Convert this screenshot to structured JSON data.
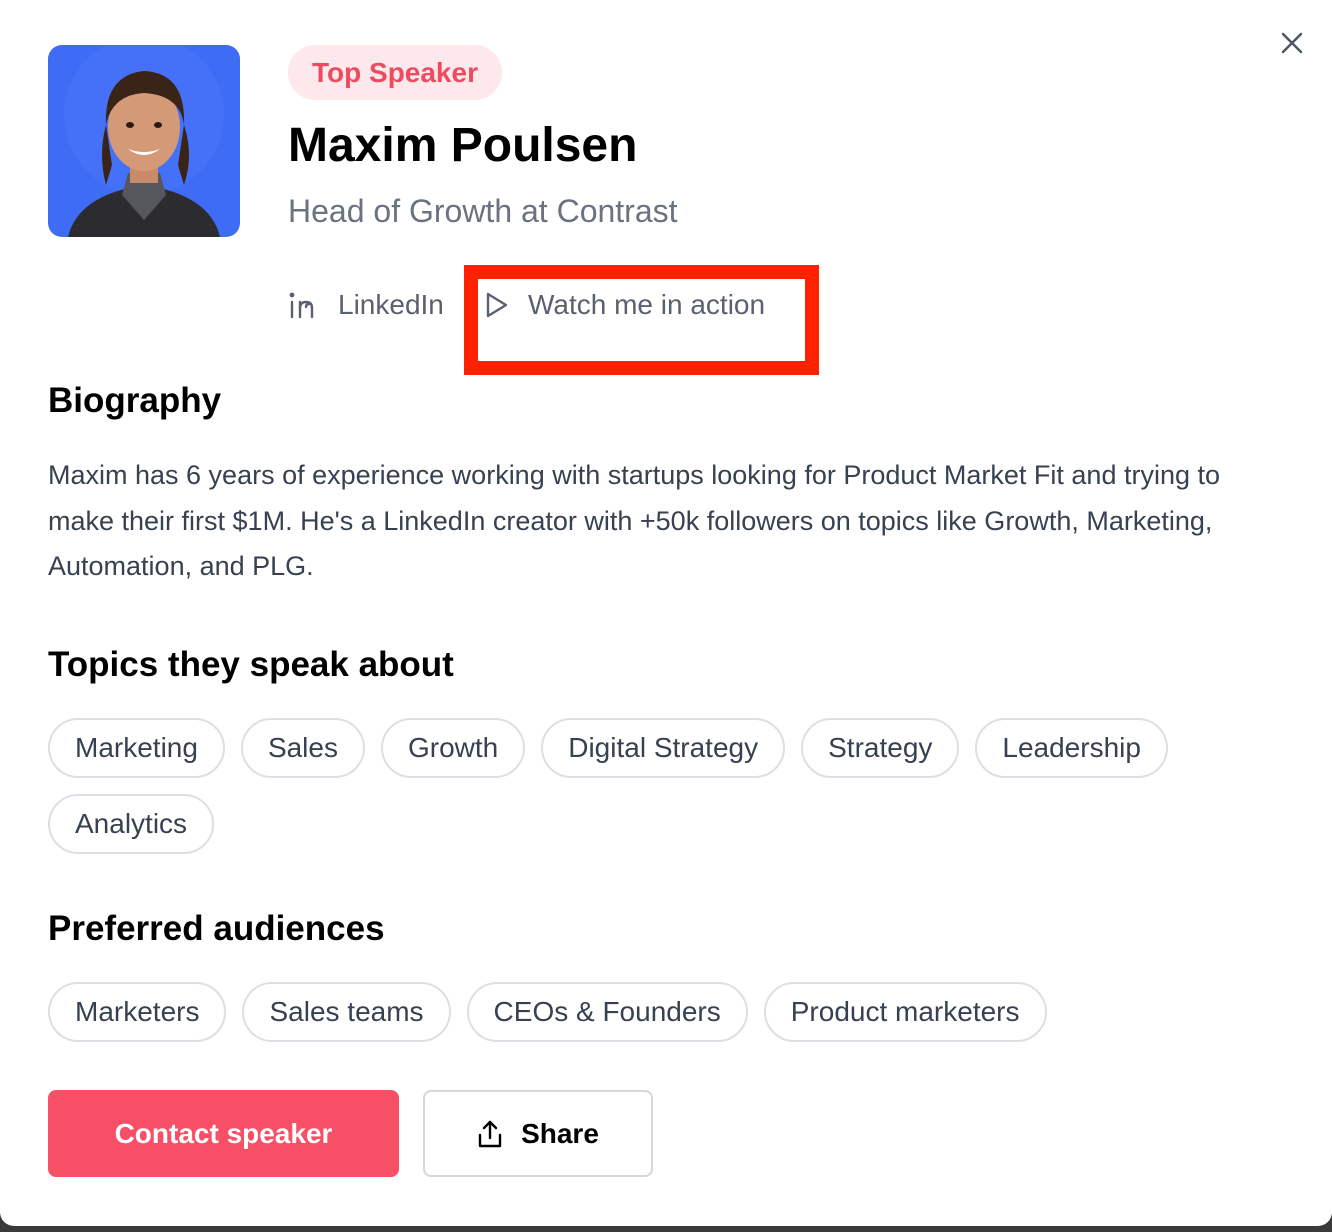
{
  "speaker": {
    "badge": "Top Speaker",
    "name": "Maxim Poulsen",
    "title": "Head of Growth at Contrast",
    "links": [
      {
        "label": "LinkedIn",
        "icon": "linkedin-icon"
      },
      {
        "label": "Watch me in action",
        "icon": "play-icon"
      }
    ]
  },
  "biography": {
    "heading": "Biography",
    "text": "Maxim has 6 years of experience working with startups looking for Product Market Fit and trying to make their first $1M. He's a LinkedIn creator with +50k followers on topics like Growth, Marketing, Automation, and PLG."
  },
  "topics": {
    "heading": "Topics they speak about",
    "items": [
      "Marketing",
      "Sales",
      "Growth",
      "Digital Strategy",
      "Strategy",
      "Leadership",
      "Analytics"
    ]
  },
  "audiences": {
    "heading": "Preferred audiences",
    "items": [
      "Marketers",
      "Sales teams",
      "CEOs & Founders",
      "Product marketers"
    ]
  },
  "actions": {
    "contact_label": "Contact speaker",
    "share_label": "Share"
  },
  "icons": {
    "close": "close-icon",
    "share": "share-icon"
  },
  "colors": {
    "accent": "#f75066",
    "badge_bg": "#fde8eb",
    "badge_text": "#ef4b60",
    "avatar_bg": "#3f6cf5",
    "highlight": "#ff2100"
  }
}
